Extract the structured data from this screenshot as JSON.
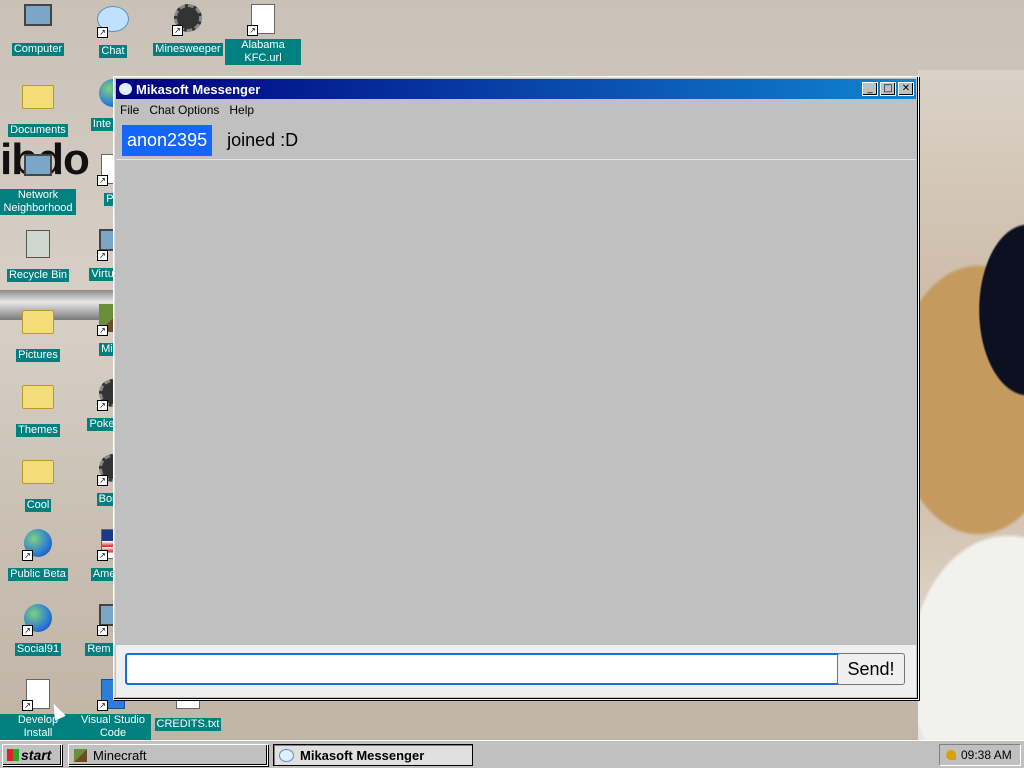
{
  "desktop": {
    "icons": [
      {
        "label": "Computer"
      },
      {
        "label": "Chat"
      },
      {
        "label": "Minesweeper"
      },
      {
        "label": "Alabama KFC.url"
      },
      {
        "label": "Documents"
      },
      {
        "label": "Inte Exp"
      },
      {
        "label": "Network Neighborhood"
      },
      {
        "label": "Pa"
      },
      {
        "label": "Recycle Bin"
      },
      {
        "label": "Virtual M"
      },
      {
        "label": "Pictures"
      },
      {
        "label": "Mine"
      },
      {
        "label": "Themes"
      },
      {
        "label": "Poke Plat"
      },
      {
        "label": "Cool"
      },
      {
        "label": "Bomb"
      },
      {
        "label": "Public Beta"
      },
      {
        "label": "America"
      },
      {
        "label": "Social91"
      },
      {
        "label": "Rem Desk"
      },
      {
        "label": "Develop Install Programs"
      },
      {
        "label": "Visual Studio Code"
      },
      {
        "label": "CREDITS.txt"
      }
    ],
    "wallpaper_text": "ibdo"
  },
  "window": {
    "title": "Mikasoft Messenger",
    "buttons": {
      "minimize": "_",
      "maximize": "□",
      "close": "✕"
    },
    "menu": [
      {
        "label": "File"
      },
      {
        "label": "Chat Options"
      },
      {
        "label": "Help"
      }
    ],
    "messages": [
      {
        "user": "anon2395",
        "text": "joined :D"
      }
    ],
    "input": {
      "value": "",
      "placeholder": ""
    },
    "send_label": "Send!"
  },
  "taskbar": {
    "start_label": "start",
    "tasks": [
      {
        "label": "Minecraft",
        "active": false
      },
      {
        "label": "Mikasoft Messenger",
        "active": true
      }
    ],
    "clock": "09:38 AM"
  },
  "colors": {
    "desktop_label_bg": "#00807f",
    "username_bg": "#1565ff",
    "title_gradient_start": "#000080",
    "title_gradient_end": "#1084d0"
  }
}
